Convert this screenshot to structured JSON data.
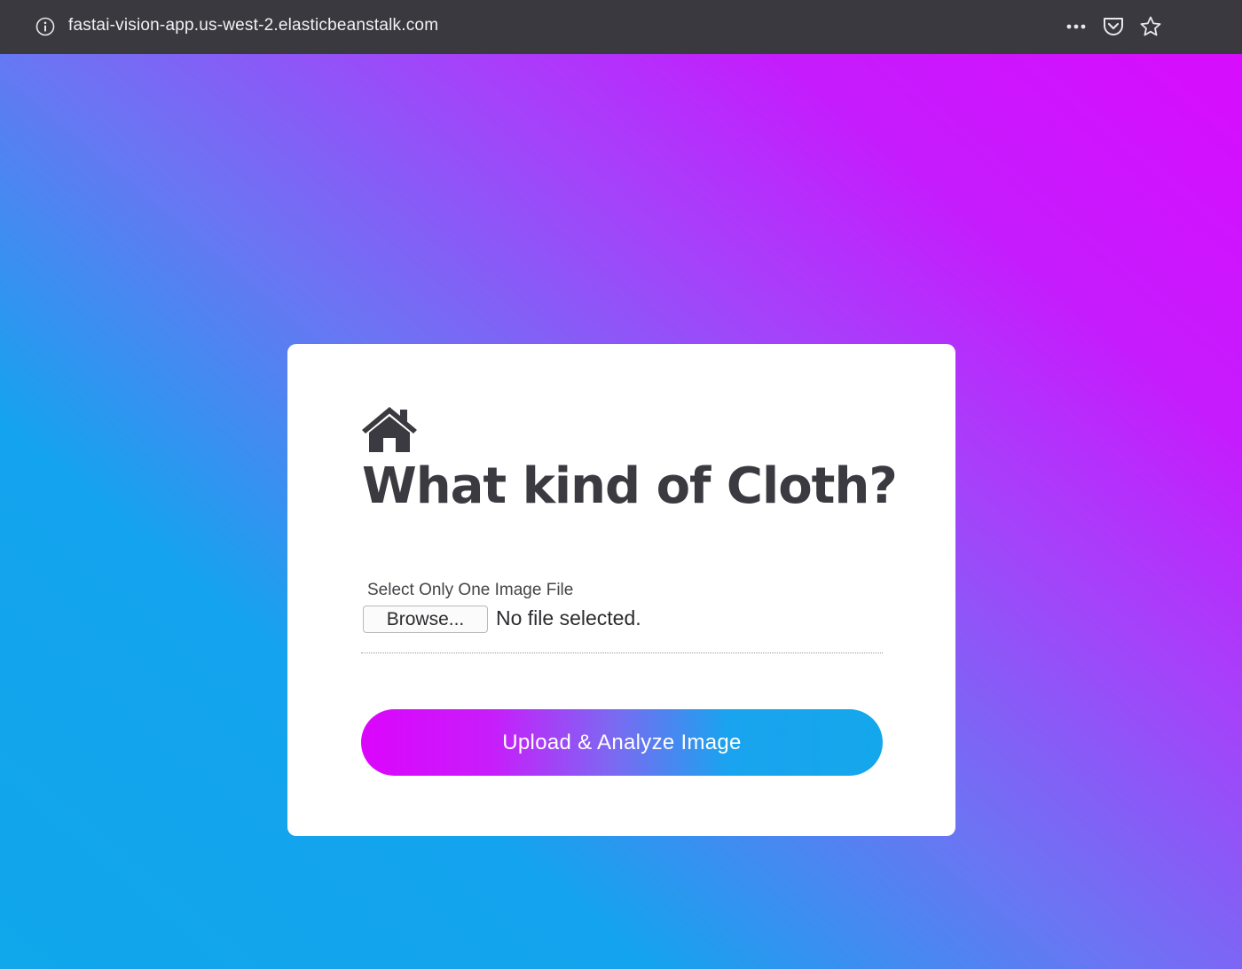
{
  "browser": {
    "url": "fastai-vision-app.us-west-2.elasticbeanstalk.com",
    "icons": {
      "info": "info-icon",
      "more": "more-icon",
      "pocket": "pocket-icon",
      "bookmark": "star-icon"
    }
  },
  "card": {
    "home_icon": "home-icon",
    "title": "What kind of Cloth?",
    "file_label": "Select Only One Image File",
    "browse_label": "Browse...",
    "file_status": "No file selected.",
    "upload_label": "Upload & Analyze Image"
  },
  "colors": {
    "gradient_blue": "#10a7eb",
    "gradient_magenta": "#d80cfe",
    "title_text": "#3b3a40",
    "browser_bar": "#3a393f"
  }
}
